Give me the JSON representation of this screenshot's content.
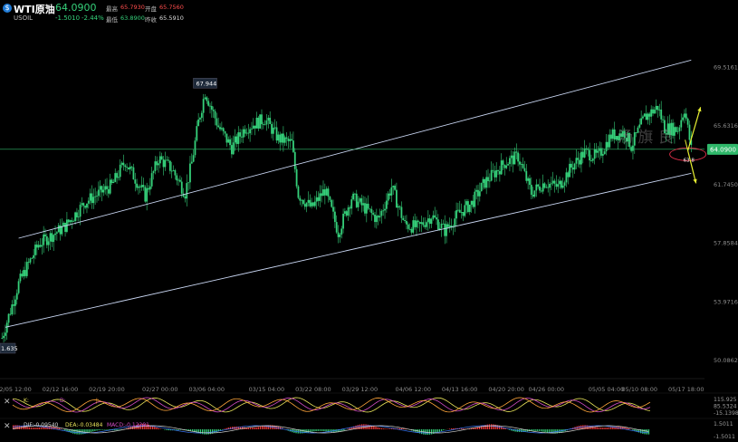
{
  "header": {
    "logo_icon": "oil-drop-icon",
    "symbol": "WTI原油",
    "code": "USOIL",
    "last": "64.0900",
    "change": "-1.5010",
    "change_pct": "-2.44%",
    "high_label": "最高",
    "high": "65.7930",
    "open_label": "开盘",
    "open": "65.7560",
    "low_label": "最低",
    "low": "63.8900",
    "prev_label": "昨收",
    "prev": "65.5910"
  },
  "chart_data": {
    "type": "candlestick",
    "price_axis_ticks": [
      "69.5161",
      "65.6316",
      "61.7450",
      "57.8584",
      "53.9716",
      "50.0862"
    ],
    "time_axis_ticks": [
      "02/05 12:00",
      "02/12 16:00",
      "02/19 20:00",
      "02/27 00:00",
      "03/06 04:00",
      "03/15 04:00",
      "03/22 08:00",
      "03/29 12:00",
      "04/06 12:00",
      "04/13 16:00",
      "04/20 20:00",
      "04/26 00:00",
      "05/05 04:00",
      "05/10 08:00",
      "05/17 18:00"
    ],
    "ylim": [
      48.9,
      72.3
    ],
    "current_price_label": "64.0900",
    "annotations": {
      "high_marker": "67.944",
      "low_marker": "1.635",
      "target_marker": "63.8"
    },
    "trend_channel": {
      "upper": [
        [
          "02/06",
          58.2
        ],
        [
          "05/18",
          70.0
        ]
      ],
      "lower": [
        [
          "02/04",
          52.3
        ],
        [
          "05/18",
          62.5
        ]
      ]
    },
    "indicator_1": {
      "ticks": [
        "115.925",
        "85.5324",
        "-15.1398"
      ],
      "labels": [
        "K:",
        "D:",
        "J:"
      ]
    },
    "indicator_2": {
      "name": "MACD",
      "ticks": [
        "1.5011",
        "-1.5011"
      ],
      "labels": [
        "DIF:",
        "DEA:",
        "MACD:"
      ],
      "values": [
        "-0.09540",
        "-0.03484",
        "-0.12291"
      ]
    },
    "colors": {
      "up": "#35d07a",
      "down": "#35d07a",
      "channel": "#c9d6f2",
      "price_line": "#2fb86a",
      "arrow": "#e8f033",
      "watermark": "#8a8a8a"
    },
    "watermark": "汤 旗 良"
  }
}
